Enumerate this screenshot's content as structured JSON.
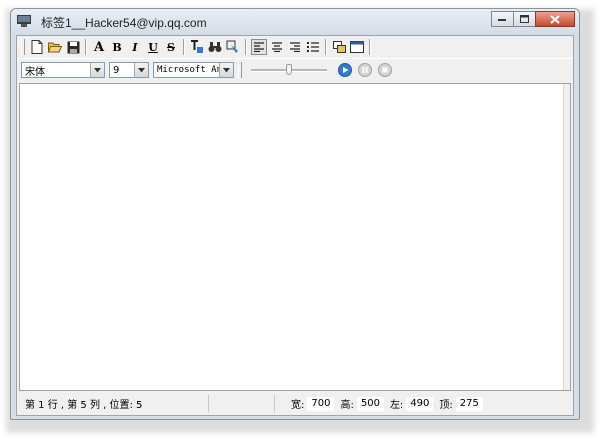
{
  "window": {
    "title": "标签1__Hacker54@vip.qq.com",
    "buttons": {
      "minimize": "minimize-icon",
      "maximize": "maximize-icon",
      "close": "close-icon"
    }
  },
  "toolbar": {
    "icons": [
      "new-file-icon",
      "open-folder-icon",
      "save-icon",
      "font-icon",
      "bold-icon",
      "italic-icon",
      "underline-icon",
      "strikethrough-icon",
      "text-color-icon",
      "find-icon",
      "replace-icon",
      "align-left-icon",
      "align-center-icon",
      "align-right-icon",
      "bullet-list-icon",
      "copy-window-icon",
      "window-icon"
    ],
    "font_glyph": "A",
    "bold_glyph": "B",
    "italic_glyph": "I",
    "underline_glyph": "U",
    "strike_glyph": "S"
  },
  "format": {
    "font_name": "宋体",
    "font_size": "9",
    "font_face": "Microsoft Ann",
    "slider_level": 0.5
  },
  "media": {
    "icons": [
      "play-icon",
      "pause-icon",
      "stop-icon"
    ]
  },
  "status": {
    "position": "第 1 行 , 第 5 列 , 位置: 5",
    "width_label": "宽:",
    "width_value": "700",
    "height_label": "高:",
    "height_value": "500",
    "left_label": "左:",
    "left_value": "490",
    "top_label": "顶:",
    "top_value": "275"
  },
  "colors": {
    "accent": "#2f7ec7",
    "close": "#c9492f"
  }
}
